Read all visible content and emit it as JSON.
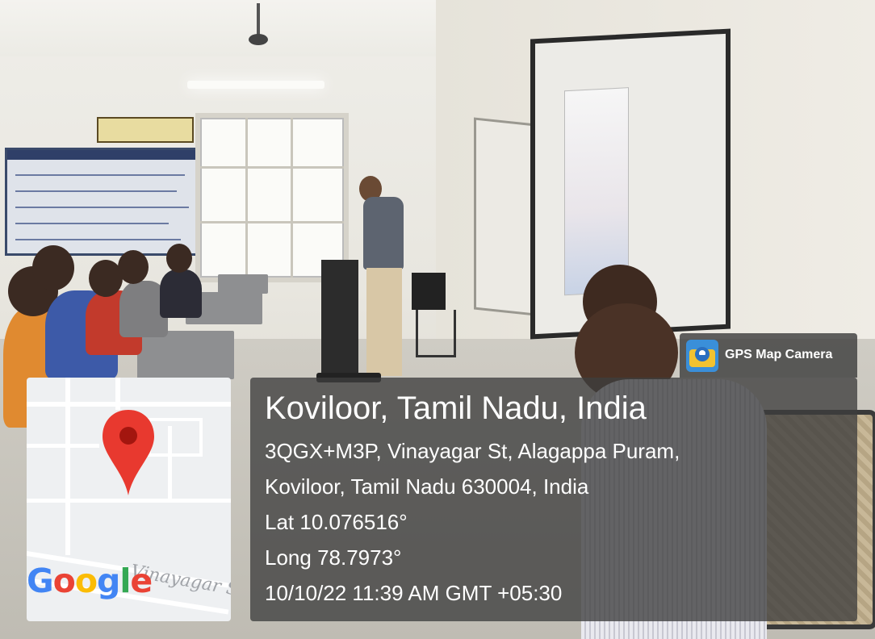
{
  "overlay": {
    "app_name": "GPS Map Camera",
    "location_title": "Koviloor, Tamil Nadu, India",
    "address_line_1": "3QGX+M3P, Vinayagar St, Alagappa Puram,",
    "address_line_2": "Koviloor, Tamil Nadu 630004, India",
    "latitude": "Lat 10.076516°",
    "longitude": "Long 78.7973°",
    "datetime": "10/10/22 11:39 AM GMT +05:30"
  },
  "map": {
    "provider_logo": "Google",
    "street_label": "Vinayagar St",
    "pin_icon": "map-pin-icon",
    "pin_color": "#e8392f",
    "logo_colors": [
      "#4285f4",
      "#ea4335",
      "#fbbc05",
      "#4285f4",
      "#34a853",
      "#ea4335"
    ]
  },
  "colors": {
    "overlay_bg": "#3e3e3e",
    "overlay_text": "#ffffff",
    "app_icon_bg": "#3a8fd9"
  }
}
